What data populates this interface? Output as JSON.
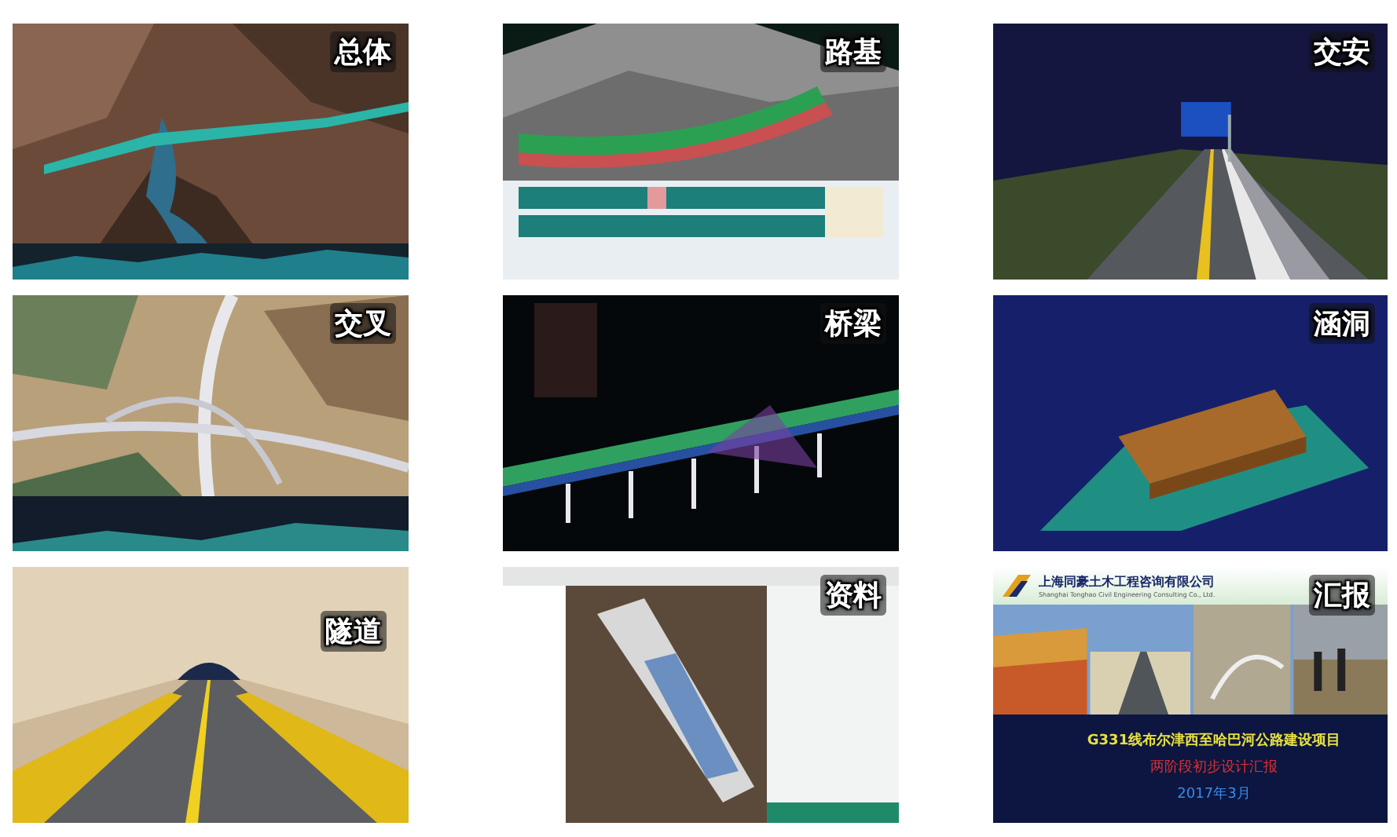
{
  "panels": [
    {
      "kind": "picture",
      "label": "总体"
    },
    {
      "kind": "picture",
      "label": "路基"
    },
    {
      "kind": "picture",
      "label": "交安"
    },
    {
      "kind": "picture",
      "label": "交叉"
    },
    {
      "kind": "picture",
      "label": "桥梁"
    },
    {
      "kind": "picture",
      "label": "涵洞"
    },
    {
      "kind": "picture",
      "label": "隧道"
    },
    {
      "kind": "picture",
      "label": "资料"
    },
    {
      "kind": "slide",
      "label": "汇报",
      "slide": {
        "company": "上海同豪土木工程咨询有限公司",
        "company_en": "Shanghai Tonghao Civil Engineering Consulting Co., Ltd.",
        "title": "G331线布尔津西至哈巴河公路建设项目",
        "subtitle": "两阶段初步设计汇报",
        "date": "2017年3月"
      }
    }
  ]
}
